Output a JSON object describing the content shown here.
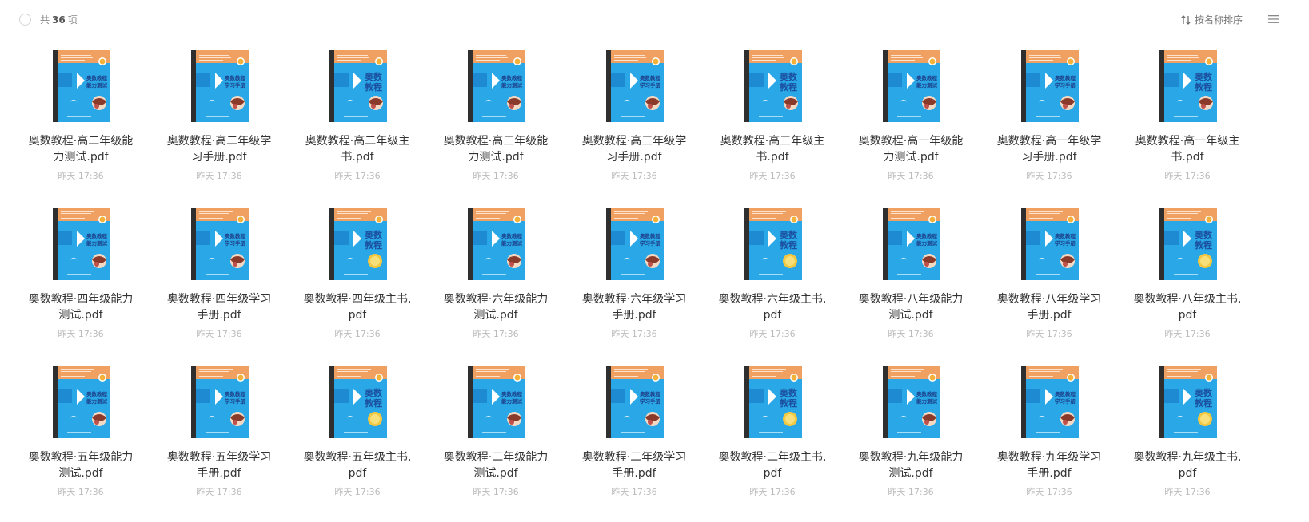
{
  "toolbar": {
    "count_prefix": "共",
    "count_value": "36",
    "count_suffix": "项",
    "sort_label": "按名称排序"
  },
  "colors": {
    "cover_blue": "#29a7e6",
    "cover_orange": "#f0a060",
    "cover_spine": "#2f2f2f"
  },
  "files": [
    {
      "name": "奥数教程·高二年级能力测试.pdf",
      "time": "昨天 17:36",
      "cover": "test"
    },
    {
      "name": "奥数教程·高二年级学习手册.pdf",
      "time": "昨天 17:36",
      "cover": "handbook"
    },
    {
      "name": "奥数教程·高二年级主书.pdf",
      "time": "昨天 17:36",
      "cover": "main"
    },
    {
      "name": "奥数教程·高三年级能力测试.pdf",
      "time": "昨天 17:36",
      "cover": "test"
    },
    {
      "name": "奥数教程·高三年级学习手册.pdf",
      "time": "昨天 17:36",
      "cover": "handbook"
    },
    {
      "name": "奥数教程·高三年级主书.pdf",
      "time": "昨天 17:36",
      "cover": "main"
    },
    {
      "name": "奥数教程·高一年级能力测试.pdf",
      "time": "昨天 17:36",
      "cover": "test"
    },
    {
      "name": "奥数教程·高一年级学习手册.pdf",
      "time": "昨天 17:36",
      "cover": "handbook"
    },
    {
      "name": "奥数教程·高一年级主书.pdf",
      "time": "昨天 17:36",
      "cover": "main"
    },
    {
      "name": "奥数教程·四年级能力测试.pdf",
      "time": "昨天 17:36",
      "cover": "test"
    },
    {
      "name": "奥数教程·四年级学习手册.pdf",
      "time": "昨天 17:36",
      "cover": "handbook"
    },
    {
      "name": "奥数教程·四年级主书.pdf",
      "time": "昨天 17:36",
      "cover": "main-gold"
    },
    {
      "name": "奥数教程·六年级能力测试.pdf",
      "time": "昨天 17:36",
      "cover": "test"
    },
    {
      "name": "奥数教程·六年级学习手册.pdf",
      "time": "昨天 17:36",
      "cover": "handbook"
    },
    {
      "name": "奥数教程·六年级主书.pdf",
      "time": "昨天 17:36",
      "cover": "main-gold"
    },
    {
      "name": "奥数教程·八年级能力测试.pdf",
      "time": "昨天 17:36",
      "cover": "test"
    },
    {
      "name": "奥数教程·八年级学习手册.pdf",
      "time": "昨天 17:36",
      "cover": "handbook"
    },
    {
      "name": "奥数教程·八年级主书.pdf",
      "time": "昨天 17:36",
      "cover": "main-gold"
    },
    {
      "name": "奥数教程·五年级能力测试.pdf",
      "time": "昨天 17:36",
      "cover": "test"
    },
    {
      "name": "奥数教程·五年级学习手册.pdf",
      "time": "昨天 17:36",
      "cover": "handbook"
    },
    {
      "name": "奥数教程·五年级主书.pdf",
      "time": "昨天 17:36",
      "cover": "main-gold"
    },
    {
      "name": "奥数教程·二年级能力测试.pdf",
      "time": "昨天 17:36",
      "cover": "test"
    },
    {
      "name": "奥数教程·二年级学习手册.pdf",
      "time": "昨天 17:36",
      "cover": "handbook"
    },
    {
      "name": "奥数教程·二年级主书.pdf",
      "time": "昨天 17:36",
      "cover": "main-gold"
    },
    {
      "name": "奥数教程·九年级能力测试.pdf",
      "time": "昨天 17:36",
      "cover": "test"
    },
    {
      "name": "奥数教程·九年级学习手册.pdf",
      "time": "昨天 17:36",
      "cover": "handbook"
    },
    {
      "name": "奥数教程·九年级主书.pdf",
      "time": "昨天 17:36",
      "cover": "main-gold"
    }
  ]
}
